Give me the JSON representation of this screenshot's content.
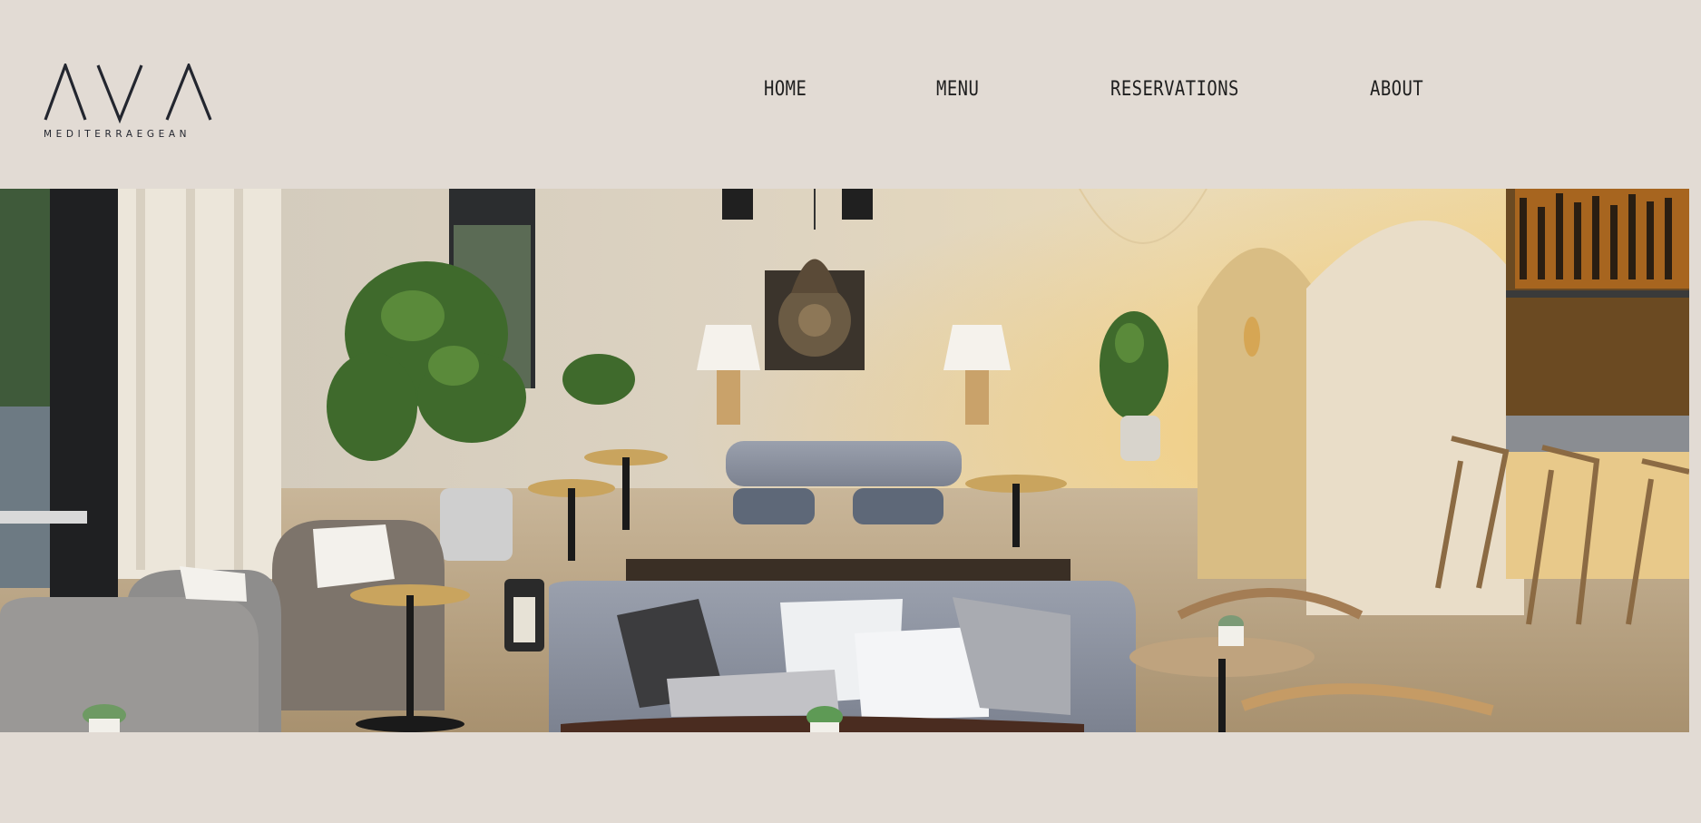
{
  "brand": {
    "name": "AVA",
    "tagline": "MEDITERRAEGEAN"
  },
  "nav": {
    "items": [
      {
        "label": "HOME"
      },
      {
        "label": "MENU"
      },
      {
        "label": "RESERVATIONS"
      },
      {
        "label": "ABOUT"
      }
    ]
  },
  "hero": {
    "alt": "Restaurant lounge interior with armchairs, sofas, plants and bar"
  },
  "colors": {
    "background": "#e2dbd4",
    "text": "#1f1f1f",
    "logo": "#23262f"
  }
}
